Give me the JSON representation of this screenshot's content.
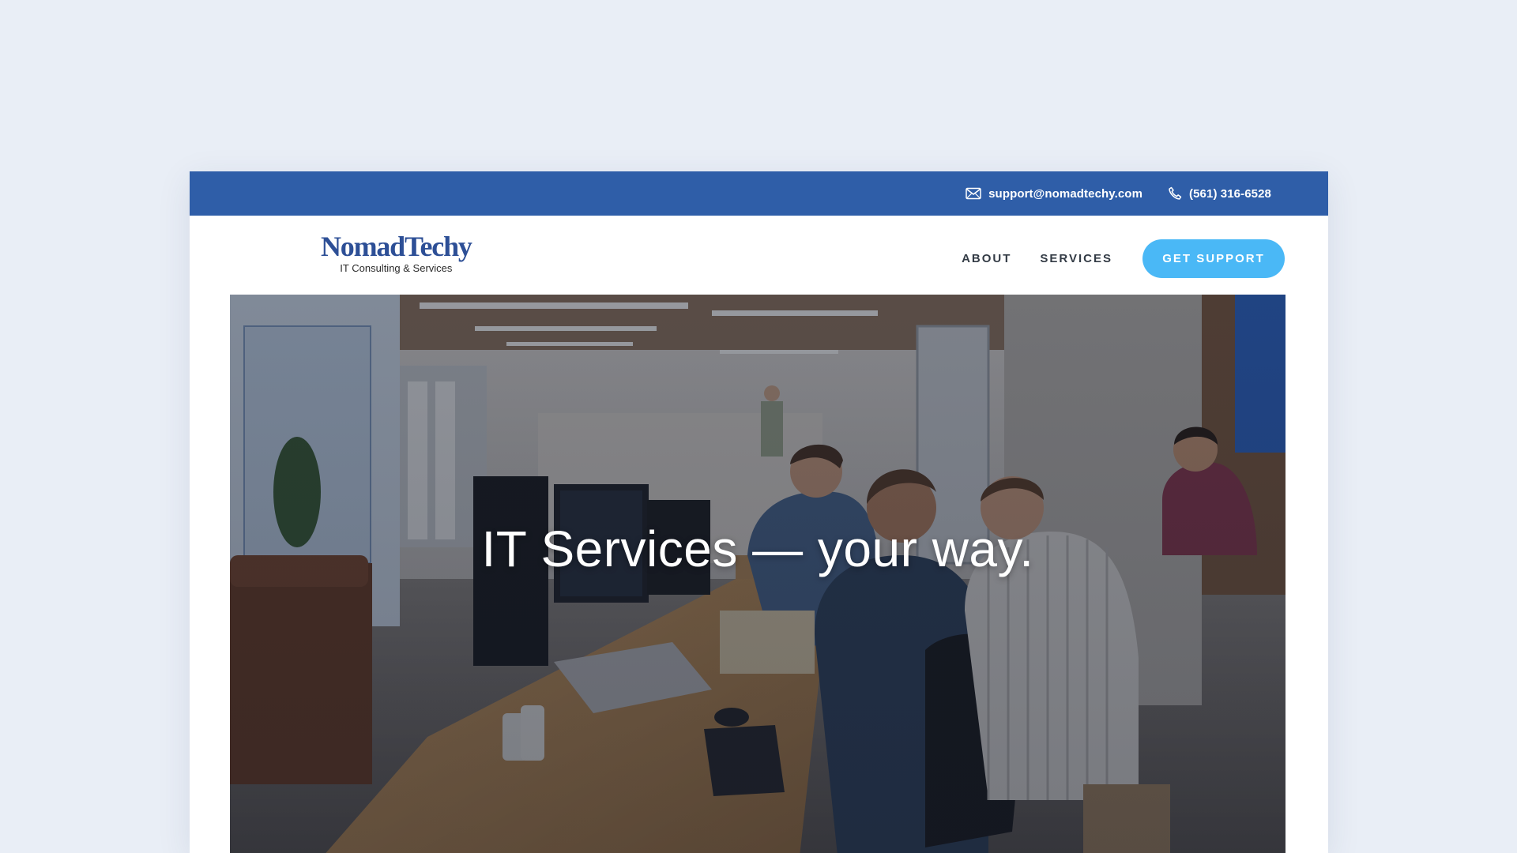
{
  "topbar": {
    "email": "support@nomadtechy.com",
    "phone": "(561) 316-6528",
    "email_icon": "envelope-icon",
    "phone_icon": "phone-icon"
  },
  "logo": {
    "name": "NomadTechy",
    "tagline": "IT Consulting & Services"
  },
  "nav": {
    "items": [
      {
        "label": "ABOUT"
      },
      {
        "label": "SERVICES"
      }
    ],
    "cta_label": "GET SUPPORT"
  },
  "hero": {
    "headline": "IT Services  —  your way."
  },
  "colors": {
    "page_background": "#e9eef6",
    "topbar": "#2f5ea8",
    "brand": "#2d4f96",
    "cta": "#4ab8f6"
  }
}
